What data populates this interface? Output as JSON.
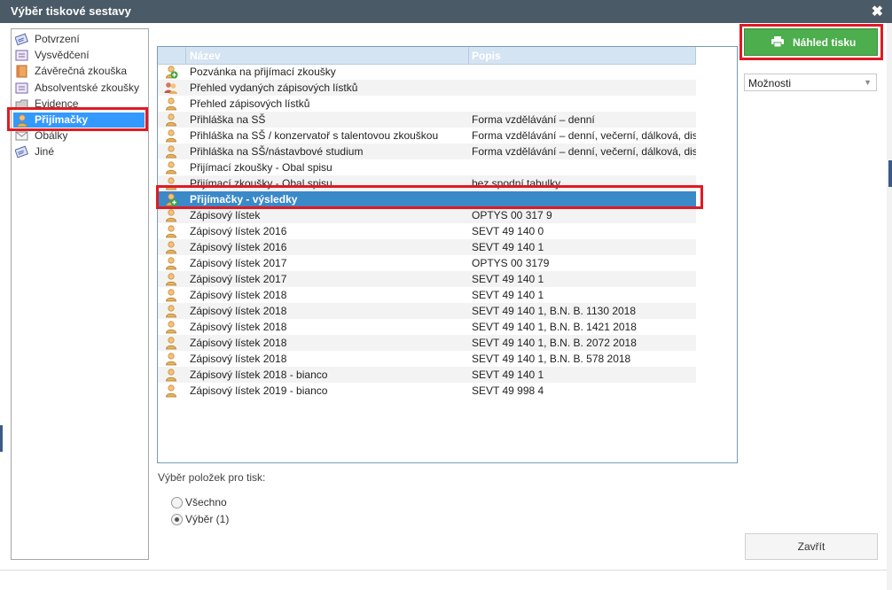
{
  "window": {
    "title": "Výběr tiskové sestavy",
    "close_glyph": "✖"
  },
  "tree": {
    "items": [
      {
        "label": "Potvrzení",
        "icon": "certificate-icon"
      },
      {
        "label": "Vysvědčení",
        "icon": "report-card-icon"
      },
      {
        "label": "Závěrečná zkouška",
        "icon": "book-icon"
      },
      {
        "label": "Absolventské zkoušky",
        "icon": "report-card-icon"
      },
      {
        "label": "Evidence",
        "icon": "folder-icon"
      },
      {
        "label": "Přijímačky",
        "icon": "person-icon"
      },
      {
        "label": "Obálky",
        "icon": "envelope-icon"
      },
      {
        "label": "Jiné",
        "icon": "certificate-icon"
      }
    ],
    "selected_index": 5
  },
  "grid": {
    "columns": [
      "Název",
      "Popis"
    ],
    "rows": [
      {
        "name": "Pozvánka na přijímací zkoušky",
        "desc": "",
        "icon": "add-person-icon"
      },
      {
        "name": "Přehled vydaných zápisových lístků",
        "desc": "",
        "icon": "person-group-icon"
      },
      {
        "name": "Přehled zápisových lístků",
        "desc": "",
        "icon": "person-icon"
      },
      {
        "name": "Přihláška na SŠ",
        "desc": "Forma vzdělávání – denní",
        "icon": "person-icon"
      },
      {
        "name": "Přihláška na SŠ / konzervatoř s talentovou zkouškou",
        "desc": "Forma vzdělávání – denní, večerní, dálková, dis",
        "icon": "person-icon"
      },
      {
        "name": "Přihláška na SŠ/nástavbové studium",
        "desc": "Forma vzdělávání – denní, večerní, dálková, dis",
        "icon": "person-icon"
      },
      {
        "name": "Přijímací zkoušky - Obal spisu",
        "desc": "",
        "icon": "person-icon"
      },
      {
        "name": "Přijímací zkoušky - Obal spisu",
        "desc": "bez spodní tabulky",
        "icon": "person-icon"
      },
      {
        "name": "Přijímačky - výsledky",
        "desc": "",
        "icon": "add-person-icon"
      },
      {
        "name": "Zápisový lístek",
        "desc": "OPTYS 00 317 9",
        "icon": "person-icon"
      },
      {
        "name": "Zápisový lístek 2016",
        "desc": "SEVT 49 140 0",
        "icon": "person-icon"
      },
      {
        "name": "Zápisový lístek 2016",
        "desc": "SEVT 49 140 1",
        "icon": "person-icon"
      },
      {
        "name": "Zápisový lístek 2017",
        "desc": "OPTYS 00 3179",
        "icon": "person-icon"
      },
      {
        "name": "Zápisový lístek 2017",
        "desc": "SEVT 49 140 1",
        "icon": "person-icon"
      },
      {
        "name": "Zápisový lístek 2018",
        "desc": "SEVT 49 140 1",
        "icon": "person-icon"
      },
      {
        "name": "Zápisový lístek 2018",
        "desc": "SEVT 49 140 1, B.N. B. 1130 2018",
        "icon": "person-icon"
      },
      {
        "name": "Zápisový lístek 2018",
        "desc": "SEVT 49 140 1, B.N. B. 1421 2018",
        "icon": "person-icon"
      },
      {
        "name": "Zápisový lístek 2018",
        "desc": "SEVT 49 140 1, B.N. B. 2072 2018",
        "icon": "person-icon"
      },
      {
        "name": "Zápisový lístek 2018",
        "desc": "SEVT 49 140 1, B.N. B. 578 2018",
        "icon": "person-icon"
      },
      {
        "name": "Zápisový lístek 2018 - bianco",
        "desc": "SEVT 49 140 1",
        "icon": "person-icon"
      },
      {
        "name": "Zápisový lístek 2019 - bianco",
        "desc": "SEVT 49 998 4",
        "icon": "person-icon"
      }
    ],
    "selected_index": 8
  },
  "preview_button": {
    "label": "Náhled tisku",
    "icon": "printer-icon"
  },
  "options_select": {
    "value": "Možnosti",
    "icon": "chevron-down-icon"
  },
  "print_selection": {
    "label": "Výběr položek pro tisk:",
    "options": [
      {
        "label": "Všechno",
        "checked": false
      },
      {
        "label": "Výběr (1)",
        "checked": true
      }
    ]
  },
  "close_button": {
    "label": "Zavřít"
  },
  "colors": {
    "titlebar": "#4a5a66",
    "selection_tree": "#3399ff",
    "selection_grid": "#3a89c9",
    "primary_button": "#4cae4c",
    "highlight_box": "#e01a22"
  }
}
